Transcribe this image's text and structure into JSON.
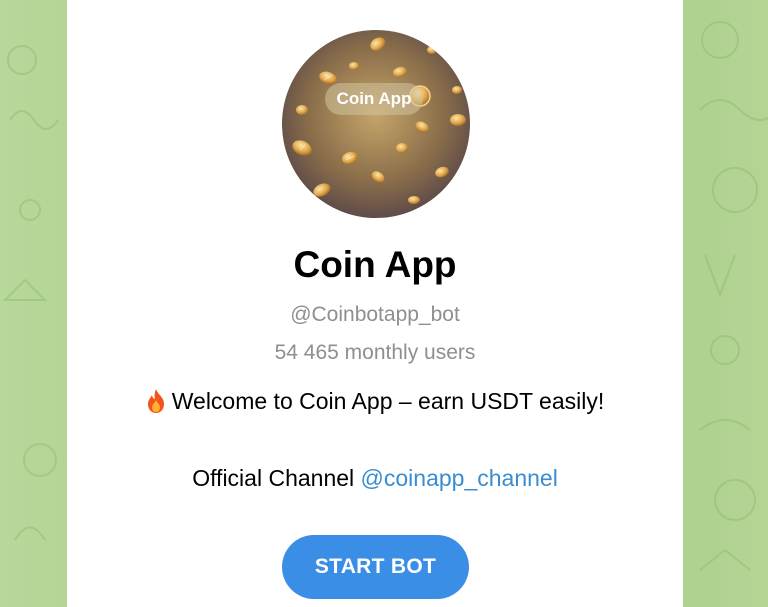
{
  "bot": {
    "avatar_label": "Coin App",
    "name": "Coin App",
    "username": "@Coinbotapp_bot",
    "monthly_users": "54 465 monthly users",
    "welcome_text": "Welcome to Coin App – earn USDT easily!",
    "channel_prefix": "Official Channel",
    "channel_link": "@coinapp_channel",
    "start_button": "START BOT"
  },
  "icons": {
    "welcome_icon": "fire-icon"
  },
  "colors": {
    "background": "#a9cf8c",
    "card": "#ffffff",
    "link": "#3a8dd0",
    "button": "#3a8ee6",
    "muted_text": "#8e8e93"
  }
}
